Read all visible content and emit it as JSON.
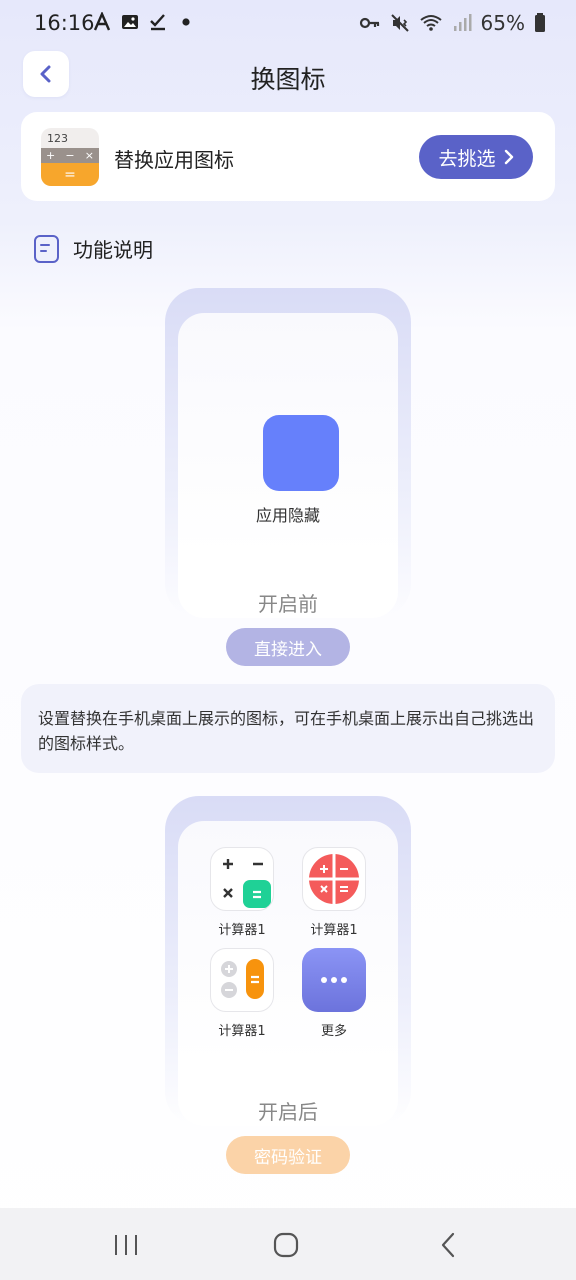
{
  "status_bar": {
    "time": "16:16",
    "left_icons": [
      "font-a-icon",
      "image-icon",
      "check-icon",
      "dot-icon"
    ],
    "right_icons": [
      "key-icon",
      "mute-vibrate-icon",
      "wifi-icon",
      "signal-icon",
      "battery-icon"
    ],
    "battery": "65%"
  },
  "header": {
    "title": "换图标",
    "back_icon": "chevron-left-icon"
  },
  "top_card": {
    "icon": {
      "number": "123",
      "ops": [
        "+",
        "−",
        "×"
      ],
      "eq": "="
    },
    "label": "替换应用图标",
    "button_label": "去挑选"
  },
  "section": {
    "icon": "document-icon",
    "title": "功能说明"
  },
  "before": {
    "app_label": "应用隐藏",
    "state": "开启前",
    "action": "直接进入"
  },
  "description": "设置替换在手机桌面上展示的图标，可在手机桌面上展示出自己挑选出的图标样式。",
  "after": {
    "apps": [
      {
        "label": "计算器1"
      },
      {
        "label": "计算器1"
      },
      {
        "label": "计算器1"
      },
      {
        "label": "更多"
      }
    ],
    "state": "开启后",
    "action": "密码验证"
  },
  "nav_bar": {
    "icons": [
      "recent-apps-icon",
      "home-icon",
      "back-icon"
    ]
  },
  "colors": {
    "accent": "#5a62c8",
    "app_icon_blue": "#6680fb",
    "pill_purple": "#b3b4e4",
    "pill_orange": "#fbd3a8",
    "calc_green": "#1fd196",
    "calc_red": "#f45b5b",
    "calc_orange": "#f7a62c"
  }
}
